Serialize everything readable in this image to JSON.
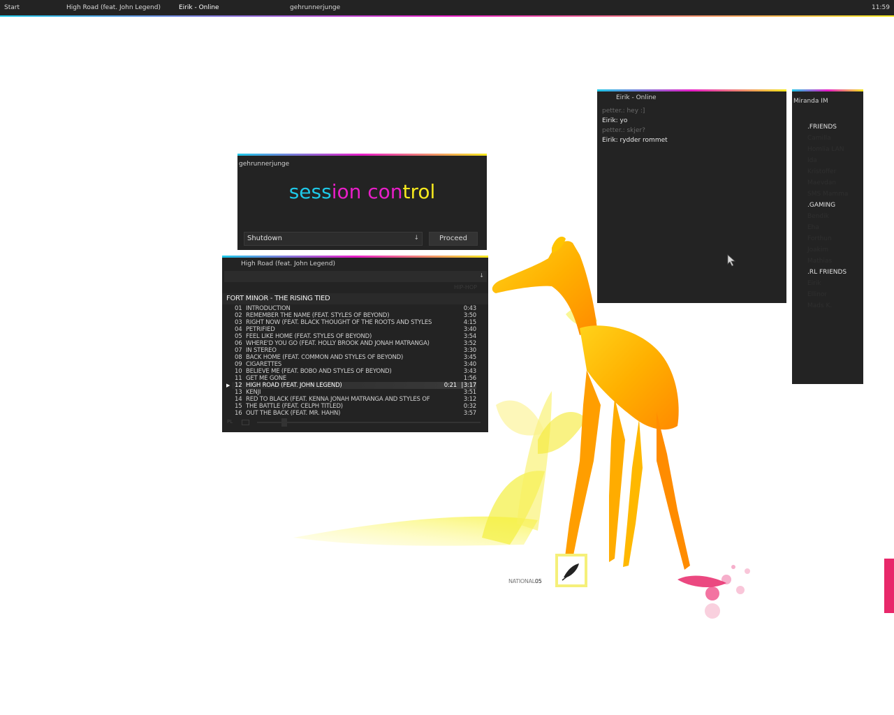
{
  "taskbar": {
    "start_label": "Start",
    "tasks": [
      "High Road (feat. John Legend)",
      "Eirik - Online",
      "gehrunnerjunge"
    ],
    "clock": "11:59"
  },
  "session": {
    "title": "gehrunnerjunge",
    "logo_parts": [
      "sess",
      "ion con",
      "trol"
    ],
    "selected_action": "Shutdown",
    "proceed_label": "Proceed"
  },
  "player": {
    "title": "High Road (feat. John Legend)",
    "genre": "HIP-HOP",
    "album": "FORT MINOR - THE RISING TIED",
    "tracks": [
      {
        "num": "01",
        "name": "INTRODUCTION",
        "dur": "0:43"
      },
      {
        "num": "02",
        "name": "REMEMBER THE NAME (FEAT. STYLES OF BEYOND)",
        "dur": "3:50"
      },
      {
        "num": "03",
        "name": "RIGHT NOW (FEAT. BLACK THOUGHT OF THE ROOTS AND STYLES",
        "dur": "4:15"
      },
      {
        "num": "04",
        "name": "PETRIFIED",
        "dur": "3:40"
      },
      {
        "num": "05",
        "name": "FEEL LIKE HOME (FEAT. STYLES OF BEYOND)",
        "dur": "3:54"
      },
      {
        "num": "06",
        "name": "WHERE'D YOU GO (FEAT. HOLLY BROOK AND JONAH MATRANGA)",
        "dur": "3:52"
      },
      {
        "num": "07",
        "name": "IN STEREO",
        "dur": "3:30"
      },
      {
        "num": "08",
        "name": "BACK HOME (FEAT. COMMON AND STYLES OF BEYOND)",
        "dur": "3:45"
      },
      {
        "num": "09",
        "name": "CIGARETTES",
        "dur": "3:40"
      },
      {
        "num": "10",
        "name": "BELIEVE ME (FEAT. BOBO AND STYLES OF BEYOND)",
        "dur": "3:43"
      },
      {
        "num": "11",
        "name": "GET ME GONE",
        "dur": "1:56"
      },
      {
        "num": "12",
        "name": "HIGH ROAD (FEAT. JOHN LEGEND)",
        "dur": "3:17",
        "pos": "0:21",
        "current": true
      },
      {
        "num": "13",
        "name": "KENJI",
        "dur": "3:51"
      },
      {
        "num": "14",
        "name": "RED TO BLACK (FEAT. KENNA JONAH MATRANGA AND STYLES OF",
        "dur": "3:12"
      },
      {
        "num": "15",
        "name": "THE BATTLE (FEAT. CELPH TITLED)",
        "dur": "0:32"
      },
      {
        "num": "16",
        "name": "OUT THE BACK (FEAT. MR. HAHN)",
        "dur": "3:57"
      }
    ],
    "pl_label": "PL",
    "seek_fraction": 0.11
  },
  "chat": {
    "title": "Eirik - Online",
    "messages": [
      {
        "text": "petter.: hey :]",
        "from": "them"
      },
      {
        "text": "Eirik: yo",
        "from": "me"
      },
      {
        "text": "petter.: skjer?",
        "from": "them"
      },
      {
        "text": "Eirik: rydder rommet",
        "from": "me"
      }
    ]
  },
  "miranda": {
    "title": "Miranda IM",
    "contacts": [
      {
        "label": ".FRIENDS",
        "type": "group"
      },
      {
        "label": "Camilla",
        "type": "off"
      },
      {
        "label": "Homlia LAN",
        "type": "off"
      },
      {
        "label": "Ida",
        "type": "off"
      },
      {
        "label": "Kristoffer",
        "type": "off"
      },
      {
        "label": "Maevdan",
        "type": "off"
      },
      {
        "label": "SMS Mamma",
        "type": "off"
      },
      {
        "label": ".GAMING",
        "type": "group"
      },
      {
        "label": "Bendik",
        "type": "off"
      },
      {
        "label": "Eha",
        "type": "off"
      },
      {
        "label": "Forthun",
        "type": "off"
      },
      {
        "label": "Joakim",
        "type": "off"
      },
      {
        "label": "Mathias",
        "type": "off"
      },
      {
        "label": ".RL FRIENDS",
        "type": "group"
      },
      {
        "label": "Eirik",
        "type": "off"
      },
      {
        "label": "Ellinor",
        "type": "off"
      },
      {
        "label": "Mads K.",
        "type": "off"
      }
    ]
  },
  "wallpaper": {
    "brand_prefix": "NATIONAL",
    "brand_suffix": "05"
  },
  "colors": {
    "accent_cyan": "#1ec8e8",
    "accent_magenta": "#e81ec8",
    "accent_yellow": "#f5e81e",
    "window_bg": "#232323"
  }
}
